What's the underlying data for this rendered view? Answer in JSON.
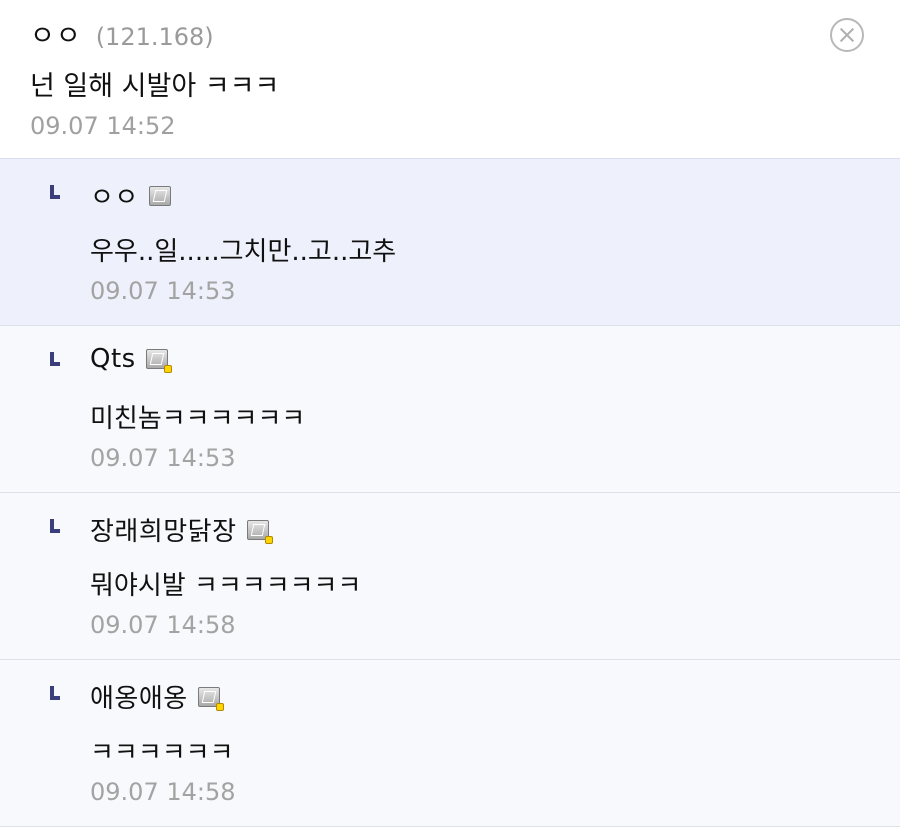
{
  "post": {
    "author": "ㅇㅇ",
    "ip": "(121.168)",
    "body": "넌 일해 시발아 ㅋㅋㅋ",
    "time": "09.07 14:52",
    "close_icon": "close-circle-icon"
  },
  "replies": [
    {
      "author": "ㅇㅇ",
      "body": "우우..일.....그치만..고..고추",
      "time": "09.07 14:53",
      "badge": "fluid-nick-icon"
    },
    {
      "author": "Qts",
      "body": "미친놈ㅋㅋㅋㅋㅋㅋ",
      "time": "09.07 14:53",
      "badge": "fixed-nick-icon"
    },
    {
      "author": "장래희망닭장",
      "body": "뭐야시발 ㅋㅋㅋㅋㅋㅋㅋ",
      "time": "09.07 14:58",
      "badge": "fixed-nick-icon"
    },
    {
      "author": "애옹애옹",
      "body": "ㅋㅋㅋㅋㅋㅋ",
      "time": "09.07 14:58",
      "badge": "fixed-nick-icon"
    }
  ],
  "colors": {
    "highlight_bg": "#eef1fb",
    "reply_bg": "#f8f9fc",
    "reply_arrow": "#3a3f7c",
    "timestamp": "#a3a3a3"
  }
}
